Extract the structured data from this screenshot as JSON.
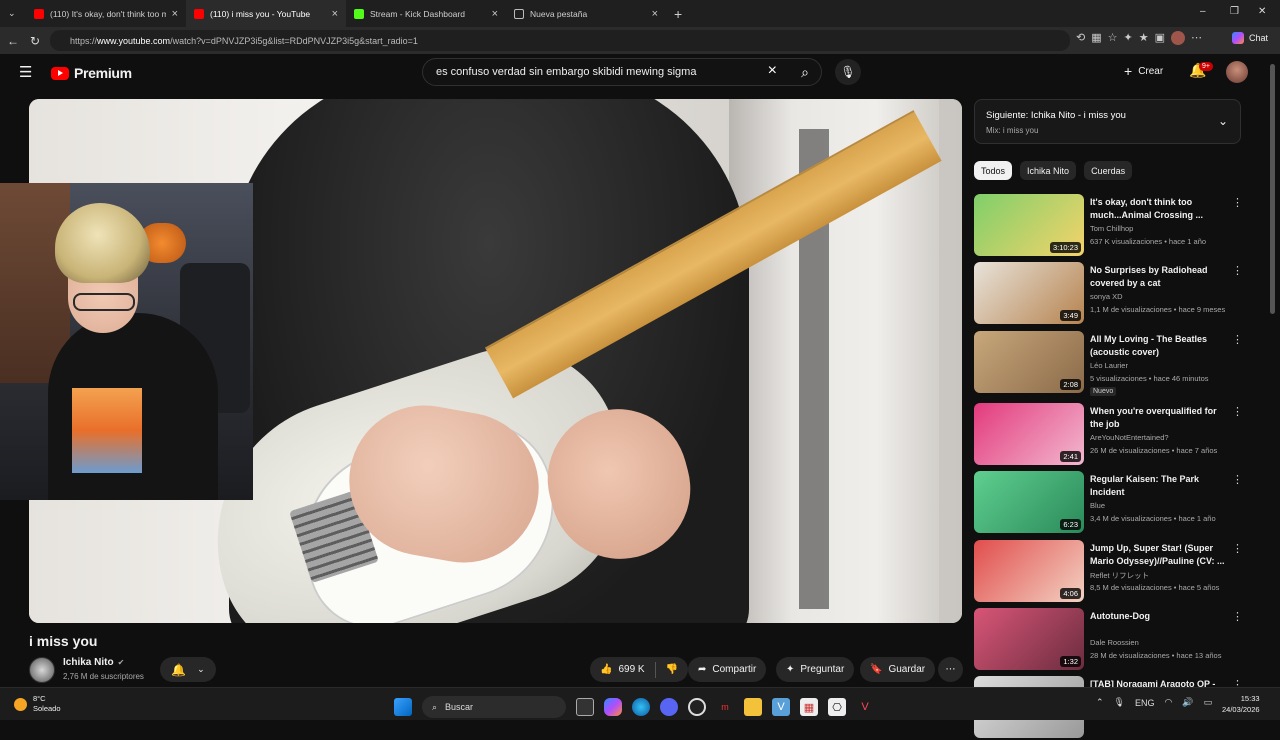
{
  "browser": {
    "tabs": [
      {
        "label": "(110) It's okay, don't think too mu",
        "color": "#ff0000"
      },
      {
        "label": "(110) i miss you - YouTube",
        "color": "#ff0000"
      },
      {
        "label": "Stream - Kick Dashboard",
        "color": "#53fc18"
      },
      {
        "label": "Nueva pestaña",
        "color": "#bbbbbb"
      }
    ],
    "new_tab_symbol": "+",
    "url_prefix": "https://",
    "url_host": "www.youtube.com",
    "url_path": "/watch?v=dPNVJZP3i5g&list=RDdPNVJZP3i5g&start_radio=1",
    "chat_label": "Chat"
  },
  "header": {
    "brand": "Premium",
    "search_query": "es confuso verdad sin embargo skibidi mewing sigma",
    "create_label": "Crear",
    "notifications_badge": "9+"
  },
  "video": {
    "title": "i miss you",
    "channel": "Ichika Nito",
    "subscribers": "2,76 M de suscriptores",
    "likes": "699 K",
    "share_label": "Compartir",
    "ask_label": "Preguntar",
    "save_label": "Guardar"
  },
  "sidebar": {
    "next_title": "Siguiente: Ichika Nito - i miss you",
    "next_sub": "Mix: i miss you",
    "chips": [
      "Todos",
      "Ichika Nito",
      "Cuerdas"
    ],
    "recommendations": [
      {
        "title": "It's okay, don't think too much...Animal Crossing ...",
        "channel": "Tom Chillhop",
        "meta": "637 K visualizaciones • hace 1 año",
        "duration": "3:10:23",
        "colors": [
          "#7fcf6a",
          "#f5d36a"
        ]
      },
      {
        "title": "No Surprises by Radiohead covered by a cat",
        "channel": "sonya XD",
        "meta": "1,1 M de visualizaciones • hace 9 meses",
        "duration": "3:49",
        "colors": [
          "#e8e3da",
          "#b6834f"
        ]
      },
      {
        "title": "All My Loving - The Beatles (acoustic cover)",
        "channel": "Léo Laurier",
        "meta": "5 visualizaciones • hace 46 minutos",
        "duration": "2:08",
        "badge": "Nuevo",
        "colors": [
          "#c7a77a",
          "#8b6a4a"
        ]
      },
      {
        "title": "When you're overqualified for the job",
        "channel": "AreYouNotEntertained?",
        "meta": "26 M de visualizaciones • hace 7 años",
        "duration": "2:41",
        "colors": [
          "#e33a7d",
          "#f2b8cf"
        ]
      },
      {
        "title": "Regular Kaisen: The Park Incident",
        "channel": "Blue",
        "meta": "3,4 M de visualizaciones • hace 1 año",
        "duration": "6:23",
        "colors": [
          "#5fcf8f",
          "#2a8a5a"
        ]
      },
      {
        "title": "Jump Up, Super Star! (Super Mario Odyssey)//Pauline (CV: ...",
        "channel": "Reflet リフレット",
        "meta": "8,5 M de visualizaciones • hace 5 años",
        "duration": "4:06",
        "colors": [
          "#e14d4d",
          "#f3d2c2"
        ]
      },
      {
        "title": "Autotune-Dog",
        "channel": "Dale Roossien",
        "meta": "28 M de visualizaciones • hace 13 años",
        "duration": "1:32",
        "colors": [
          "#d85577",
          "#6b2d3f"
        ]
      },
      {
        "title": "[TAB] Noragami Aragoto OP - ...",
        "channel": "",
        "meta": "",
        "duration": "",
        "colors": [
          "#dddddd",
          "#999999"
        ]
      }
    ]
  },
  "taskbar": {
    "temp": "8°C",
    "weather": "Soleado",
    "search_label": "Buscar",
    "lang": "ENG",
    "time": "15:33",
    "date": "24/03/2026"
  }
}
